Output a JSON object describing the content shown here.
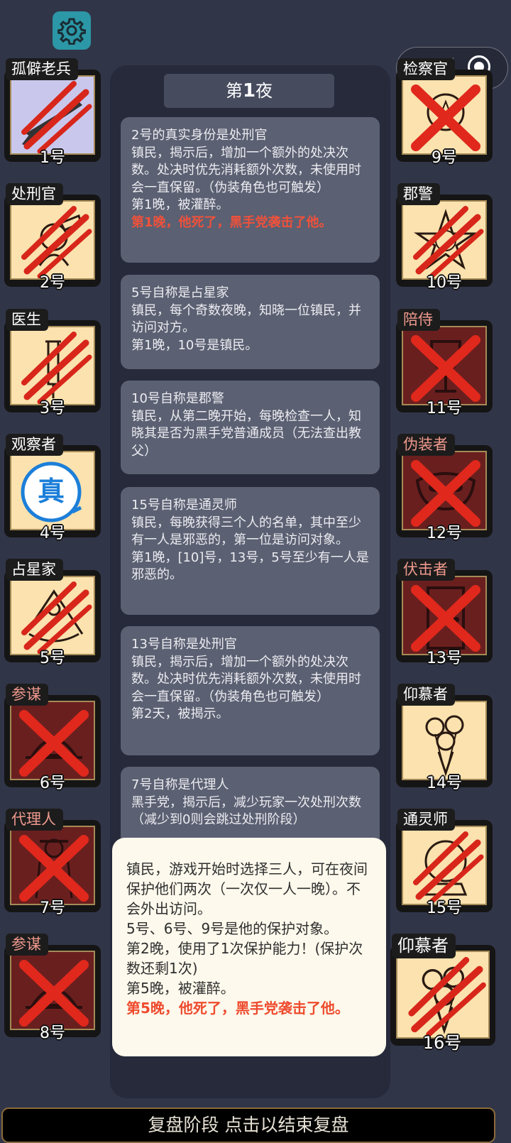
{
  "night": {
    "prefix": "第",
    "number": "1",
    "suffix": "夜"
  },
  "cards": [
    {
      "lines": [
        {
          "text": "2号的真实身份是处刑官",
          "red": false
        },
        {
          "text": "镇民，揭示后，增加一个额外的处决次数。处决时优先消耗额外次数，未使用时会一直保留。（伪装角色也可触发）",
          "red": false
        },
        {
          "text": "第1晚，被灌醉。",
          "red": false
        },
        {
          "text": "第1晚，他死了，黑手党袭击了他。",
          "red": true
        }
      ]
    },
    {
      "lines": [
        {
          "text": "5号自称是占星家",
          "red": false
        },
        {
          "text": "镇民，每个奇数夜晚，知晓一位镇民，并访问对方。",
          "red": false
        },
        {
          "text": "第1晚，10号是镇民。",
          "red": false
        }
      ]
    },
    {
      "lines": [
        {
          "text": "10号自称是郡警",
          "red": false
        },
        {
          "text": "镇民，从第二晚开始，每晚检查一人，知晓其是否为黑手党普通成员（无法查出教父）",
          "red": false
        }
      ]
    },
    {
      "lines": [
        {
          "text": "15号自称是通灵师",
          "red": false
        },
        {
          "text": "镇民，每晚获得三个人的名单，其中至少有一人是邪恶的，第一位是访问对象。",
          "red": false
        },
        {
          "text": "第1晚，[10]号，13号，5号至少有一人是邪恶的。",
          "red": false
        }
      ]
    },
    {
      "lines": [
        {
          "text": "13号自称是处刑官",
          "red": false
        },
        {
          "text": "镇民，揭示后，增加一个额外的处决次数。处决时优先消耗额外次数，未使用时会一直保留。（伪装角色也可触发）",
          "red": false
        },
        {
          "text": "第2天，被揭示。",
          "red": false
        }
      ]
    },
    {
      "lines": [
        {
          "text": "7号自称是代理人",
          "red": false
        },
        {
          "text": "黑手党，揭示后，减少玩家一次处刑次数（减少到0则会跳过处刑阶段）",
          "red": false
        }
      ]
    }
  ],
  "popup": {
    "lines": [
      {
        "text": "镇民，游戏开始时选择三人，可在夜间保护他们两次（一次仅一人一晚）。不会外出访问。",
        "red": false
      },
      {
        "text": "5号、6号、9号是他的保护对象。",
        "red": false
      },
      {
        "text": "第2晚，使用了1次保护能力！(保护次数还剩1次)",
        "red": false
      },
      {
        "text": "第5晚，被灌醉。",
        "red": false
      },
      {
        "text": "第5晚，他死了，黑手党袭击了他。",
        "red": true
      }
    ]
  },
  "left_players": [
    {
      "role": "孤僻老兵",
      "number": "1号",
      "evil": false,
      "state": "slashed",
      "icon": "rifle-icon",
      "bg": "purple"
    },
    {
      "role": "处刑官",
      "number": "2号",
      "evil": false,
      "state": "slashed",
      "icon": "executioner-icon",
      "bg": "live"
    },
    {
      "role": "医生",
      "number": "3号",
      "evil": false,
      "state": "slashed",
      "icon": "syringe-icon",
      "bg": "live"
    },
    {
      "role": "观察者",
      "number": "4号",
      "evil": false,
      "state": "alive",
      "icon": "truth-badge-icon",
      "badge": "真",
      "bg": "live"
    },
    {
      "role": "占星家",
      "number": "5号",
      "evil": false,
      "state": "slashed",
      "icon": "sextant-icon",
      "bg": "live"
    },
    {
      "role": "参谋",
      "number": "6号",
      "evil": true,
      "state": "crossed",
      "icon": "hat-icon",
      "bg": "dead"
    },
    {
      "role": "代理人",
      "number": "7号",
      "evil": true,
      "state": "crossed",
      "icon": "agent-icon",
      "bg": "dead"
    },
    {
      "role": "参谋",
      "number": "8号",
      "evil": true,
      "state": "crossed",
      "icon": "hat-icon",
      "bg": "dead"
    }
  ],
  "right_players": [
    {
      "role": "检察官",
      "number": "9号",
      "evil": false,
      "state": "crossed",
      "icon": "badge-icon",
      "bg": "live"
    },
    {
      "role": "郡警",
      "number": "10号",
      "evil": false,
      "state": "slashed",
      "icon": "sheriff-star-icon",
      "bg": "live"
    },
    {
      "role": "陪侍",
      "number": "11号",
      "evil": true,
      "state": "crossed",
      "icon": "wine-glass-icon",
      "bg": "dead"
    },
    {
      "role": "伪装者",
      "number": "12号",
      "evil": true,
      "state": "crossed",
      "icon": "mask-icon",
      "bg": "dead"
    },
    {
      "role": "伏击者",
      "number": "13号",
      "evil": true,
      "state": "crossed",
      "icon": "door-icon",
      "bg": "dead"
    },
    {
      "role": "仰慕者",
      "number": "14号",
      "evil": false,
      "state": "alive",
      "icon": "roses-icon",
      "bg": "live"
    },
    {
      "role": "通灵师",
      "number": "15号",
      "evil": false,
      "state": "slashed",
      "icon": "crystal-ball-icon",
      "bg": "live"
    },
    {
      "role": "仰慕者",
      "number": "16号",
      "evil": false,
      "state": "slashed",
      "icon": "roses-icon",
      "bg": "live"
    }
  ],
  "bottom_bar": {
    "label": "复盘阶段 点击以结束复盘"
  },
  "colors": {
    "background": "#313548",
    "evil_label": "#f09a8e",
    "death_text": "#f0513b",
    "slash": "#d8261b",
    "tile_alive": "#fbe2ae",
    "tile_dead": "#6a1f1f"
  }
}
